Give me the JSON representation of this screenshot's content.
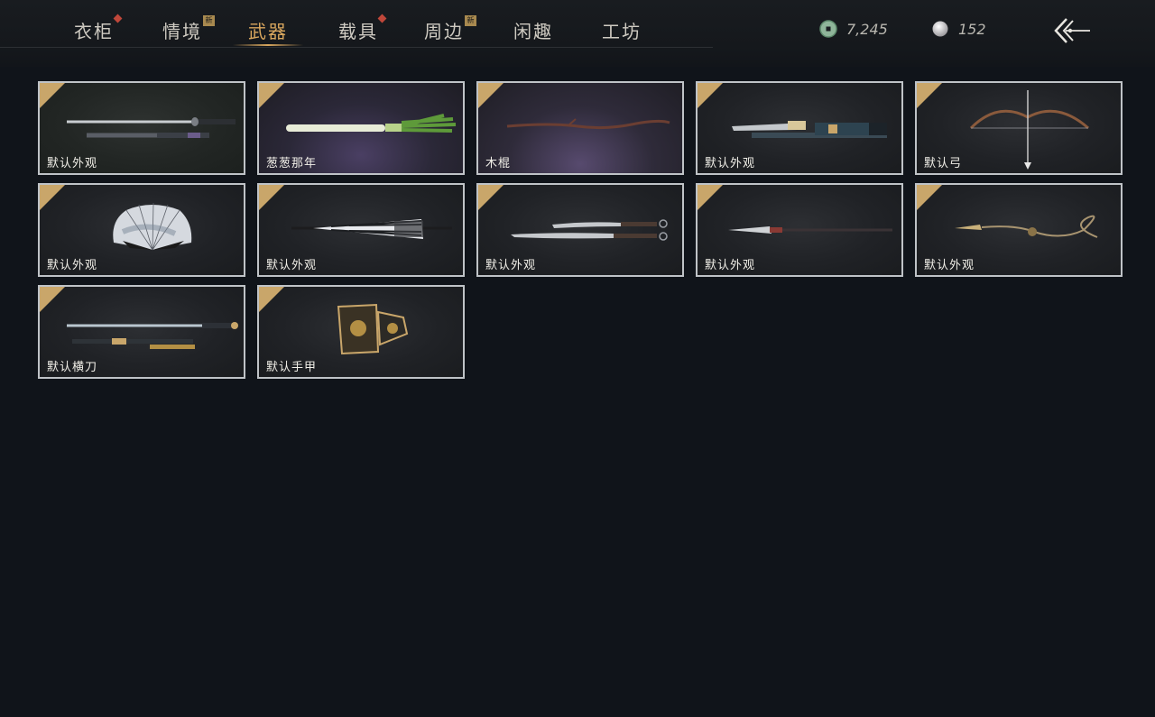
{
  "tabs": [
    {
      "label": "衣柜",
      "badge": "dot"
    },
    {
      "label": "情境",
      "badge": "new"
    },
    {
      "label": "武器",
      "badge": "",
      "active": true
    },
    {
      "label": "载具",
      "badge": "dot"
    },
    {
      "label": "周边",
      "badge": "new"
    },
    {
      "label": "闲趣",
      "badge": ""
    },
    {
      "label": "工坊",
      "badge": ""
    }
  ],
  "new_badge_text": "新",
  "currencies": [
    {
      "icon": "jade-coin-icon",
      "value": "7,245"
    },
    {
      "icon": "pearl-icon",
      "value": "152"
    }
  ],
  "back_icon": "back-arrow-icon",
  "items": [
    {
      "label": "默认外观",
      "art": "sword-pair",
      "selected": true
    },
    {
      "label": "葱葱那年",
      "art": "scallion",
      "selected": true
    },
    {
      "label": "木棍",
      "art": "stick",
      "selected": true
    },
    {
      "label": "默认外观",
      "art": "ornate-blade",
      "selected": true
    },
    {
      "label": "默认弓",
      "art": "bow",
      "selected": true
    },
    {
      "label": "默认外观",
      "art": "fan",
      "selected": true
    },
    {
      "label": "默认外观",
      "art": "umbrella",
      "selected": true
    },
    {
      "label": "默认外观",
      "art": "twin-sabres",
      "selected": true
    },
    {
      "label": "默认外观",
      "art": "spear",
      "selected": true
    },
    {
      "label": "默认外观",
      "art": "rope-dart",
      "selected": true
    },
    {
      "label": "默认横刀",
      "art": "hengdao",
      "selected": true
    },
    {
      "label": "默认手甲",
      "art": "gauntlet",
      "selected": true
    }
  ],
  "colors": {
    "accent": "#d9a75e",
    "check": "#c9a66a",
    "card_border": "#bfc3c7",
    "background": "#10141a"
  }
}
